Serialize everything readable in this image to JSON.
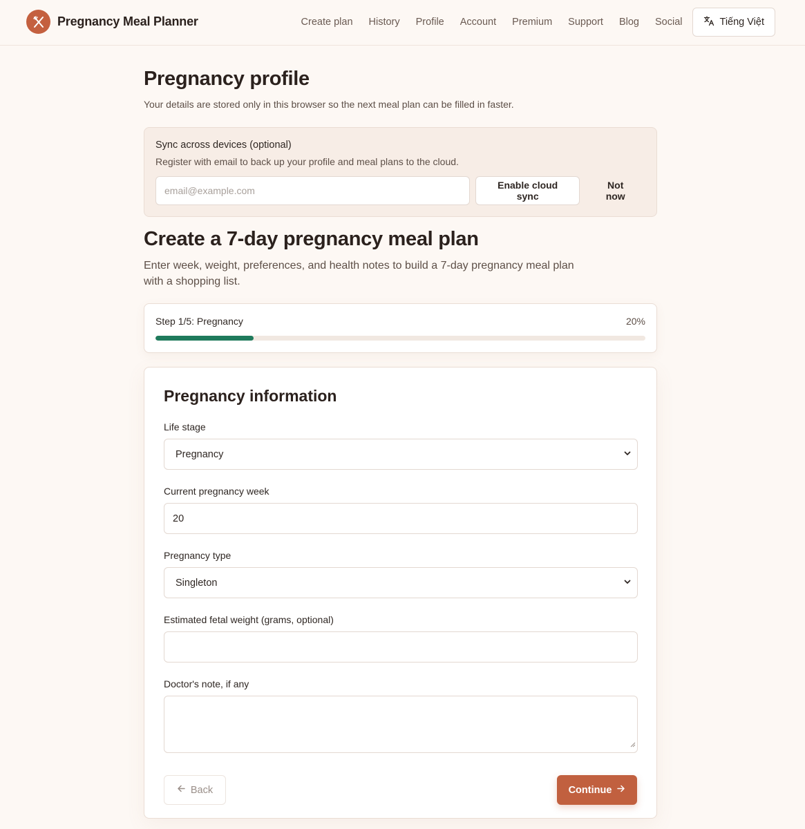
{
  "header": {
    "brand": "Pregnancy Meal Planner",
    "nav": [
      "Create plan",
      "History",
      "Profile",
      "Account",
      "Premium",
      "Support",
      "Blog",
      "Social"
    ],
    "language": "Tiếng Việt"
  },
  "profile": {
    "title": "Pregnancy profile",
    "subtitle": "Your details are stored only in this browser so the next meal plan can be filled in faster."
  },
  "sync": {
    "title": "Sync across devices (optional)",
    "description": "Register with email to back up your profile and meal plans to the cloud.",
    "email_placeholder": "email@example.com",
    "enable_label": "Enable cloud sync",
    "dismiss_label": "Not now"
  },
  "plan": {
    "title": "Create a 7-day pregnancy meal plan",
    "description": "Enter week, weight, preferences, and health notes to build a 7-day pregnancy meal plan with a shopping list."
  },
  "progress": {
    "step_label": "Step 1/5: Pregnancy",
    "percent_label": "20%",
    "value": 0.2,
    "color": "#1f7a5c"
  },
  "form": {
    "title": "Pregnancy information",
    "life_stage": {
      "label": "Life stage",
      "value": "Pregnancy"
    },
    "week": {
      "label": "Current pregnancy week",
      "value": "20"
    },
    "type": {
      "label": "Pregnancy type",
      "value": "Singleton"
    },
    "fetal_weight": {
      "label": "Estimated fetal weight (grams, optional)",
      "value": ""
    },
    "doctor_note": {
      "label": "Doctor's note, if any",
      "value": ""
    },
    "back_label": "Back",
    "continue_label": "Continue"
  },
  "colors": {
    "accent": "#c1603f",
    "background": "#fdf8f4"
  }
}
